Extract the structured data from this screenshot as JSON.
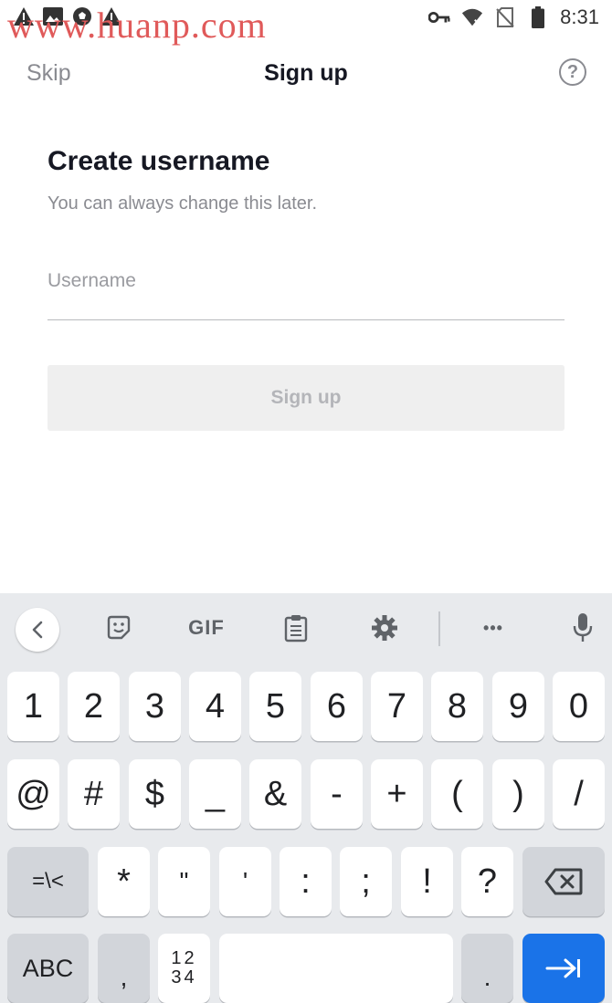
{
  "status_bar": {
    "time": "8:31",
    "watermark": "www.huanp.com",
    "left_icons": [
      "warning-icon",
      "image-icon",
      "soccer-ball-icon",
      "warning-icon"
    ],
    "right_icons": [
      "vpn-key-icon",
      "wifi-off-icon",
      "no-sim-icon",
      "battery-icon"
    ]
  },
  "header": {
    "skip_label": "Skip",
    "title": "Sign up",
    "help_glyph": "?"
  },
  "main": {
    "title": "Create username",
    "subtitle": "You can always change this later.",
    "username_placeholder": "Username",
    "username_value": "",
    "signup_button": "Sign up"
  },
  "keyboard": {
    "toolbar": {
      "gif_label": "GIF",
      "more_label": "•••"
    },
    "row1": [
      "1",
      "2",
      "3",
      "4",
      "5",
      "6",
      "7",
      "8",
      "9",
      "0"
    ],
    "row2": [
      "@",
      "#",
      "$",
      "_",
      "&",
      "-",
      "+",
      "(",
      ")",
      "/"
    ],
    "row3": {
      "symbols_key": "=\\<",
      "keys": [
        "*",
        "\"",
        "'",
        ":",
        ";",
        "!",
        "?"
      ]
    },
    "row4": {
      "abc_key": "ABC",
      "comma": ",",
      "numpad_top": "12",
      "numpad_bottom": "34",
      "space": "",
      "period": "."
    }
  }
}
